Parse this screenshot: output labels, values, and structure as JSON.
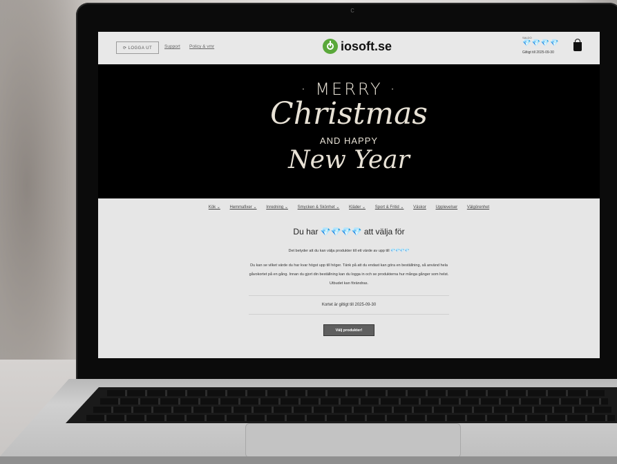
{
  "header": {
    "logout_label": "⟳ LOGGA UT",
    "links": [
      "Support",
      "Policy & vmr"
    ],
    "logo_text": "iosoft.se",
    "balance_caption": "SALDO",
    "balance_gems": "💎💎💎💎",
    "valid_until": "Giltigt till 2025-09-30"
  },
  "banner": {
    "line1": "· MERRY ·",
    "line2": "Christmas",
    "line3": "AND HAPPY",
    "line4": "New Year"
  },
  "nav": {
    "items": [
      "Kök ⌄",
      "Hemmafixer ⌄",
      "Inredning ⌄",
      "Smycken & Skönhet ⌄",
      "Kläder ⌄",
      "Sport & Fritid ⌄",
      "Väskor",
      "Upplevelser",
      "Välgörenhet"
    ]
  },
  "content": {
    "title": "Du har 💎💎💎💎 att välja för",
    "line1": "Det betyder att du kan välja produkter till ett värde av upp till 💎💎💎💎",
    "paragraph": "Du kan se vilket värde du har kvar högst upp till höger. Tänk på att du endast kan göra en beställning, så använd hela gåvokortet på en gång. Innan du gjort din beställning kan du logga in och se produkterna hur många gånger som helst. Utbudet kan förändras.",
    "valid_text": "Kortet är giltigt till 2025-09-30",
    "button_label": "Välj produkter!"
  },
  "colors": {
    "logo_green": "#5aa83a",
    "banner_bg": "#000000",
    "button_bg": "#5f5f5f"
  }
}
